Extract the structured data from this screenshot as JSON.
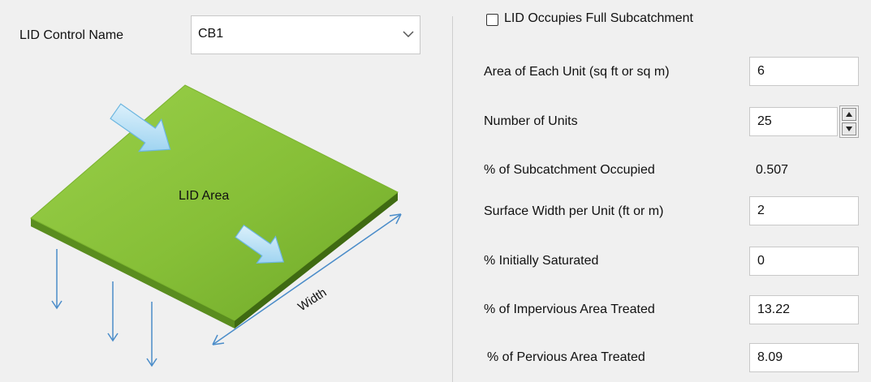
{
  "lid_control": {
    "label": "LID Control Name",
    "selected": "CB1",
    "dropdown_icon": "chevron-down-icon"
  },
  "diagram": {
    "area_label": "LID Area",
    "width_label": "Width",
    "colors": {
      "surface_top": "#8cc53f",
      "surface_edge": "#3f6a12",
      "arrow": "#9fd3f0",
      "flow": "#4a8cc9"
    }
  },
  "full_subcatchment": {
    "label": "LID Occupies Full Subcatchment",
    "checked": false
  },
  "fields": {
    "area_each_unit": {
      "label": "Area of Each Unit (sq ft or sq m)",
      "value": "6"
    },
    "number_units": {
      "label": "Number of Units",
      "value": "25"
    },
    "pct_occupied": {
      "label": "% of Subcatchment Occupied",
      "value": "0.507"
    },
    "surface_width": {
      "label": "Surface Width per Unit (ft or m)",
      "value": "2"
    },
    "init_saturated": {
      "label": "% Initially Saturated",
      "value": "0"
    },
    "impervious_treated": {
      "label": "% of Impervious Area Treated",
      "value": "13.22"
    },
    "pervious_treated": {
      "label": "% of Pervious Area Treated",
      "value": "8.09"
    }
  }
}
